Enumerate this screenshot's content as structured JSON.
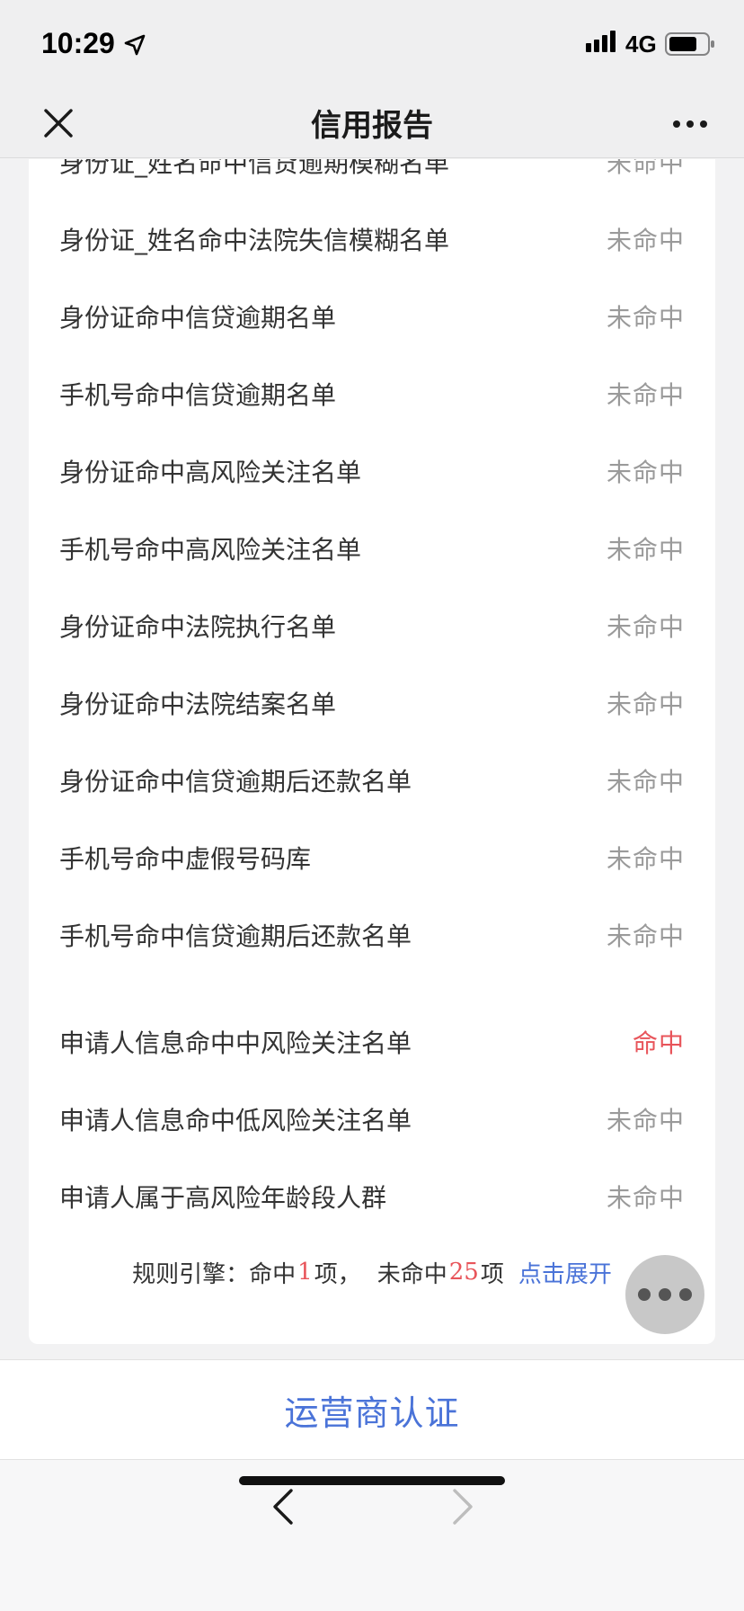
{
  "status_bar": {
    "time": "10:29",
    "network": "4G",
    "icons": [
      "location-arrow-icon",
      "signal-bars-icon",
      "battery-icon"
    ]
  },
  "nav": {
    "title": "信用报告",
    "close_icon": "close-icon",
    "more_icon": "more-dots-icon"
  },
  "rules": [
    {
      "label": "身份证_姓名命中信贷逾期模糊名单",
      "status": "未命中",
      "hit": false
    },
    {
      "label": "身份证_姓名命中法院失信模糊名单",
      "status": "未命中",
      "hit": false
    },
    {
      "label": "身份证命中信贷逾期名单",
      "status": "未命中",
      "hit": false
    },
    {
      "label": "手机号命中信贷逾期名单",
      "status": "未命中",
      "hit": false
    },
    {
      "label": "身份证命中高风险关注名单",
      "status": "未命中",
      "hit": false
    },
    {
      "label": "手机号命中高风险关注名单",
      "status": "未命中",
      "hit": false
    },
    {
      "label": "身份证命中法院执行名单",
      "status": "未命中",
      "hit": false
    },
    {
      "label": "身份证命中法院结案名单",
      "status": "未命中",
      "hit": false
    },
    {
      "label": "身份证命中信贷逾期后还款名单",
      "status": "未命中",
      "hit": false
    },
    {
      "label": "手机号命中虚假号码库",
      "status": "未命中",
      "hit": false
    },
    {
      "label": "手机号命中信贷逾期后还款名单",
      "status": "未命中",
      "hit": false
    },
    {
      "label": "申请人信息命中中风险关注名单",
      "status": "命中",
      "hit": true
    },
    {
      "label": "申请人信息命中低风险关注名单",
      "status": "未命中",
      "hit": false
    },
    {
      "label": "申请人属于高风险年龄段人群",
      "status": "未命中",
      "hit": false
    }
  ],
  "summary": {
    "prefix": "规则引擎：命中",
    "hit_count": "1",
    "hit_unit": "项，",
    "miss_prefix": "未命中",
    "miss_count": "25",
    "miss_unit": "项",
    "expand_label": "点击展开"
  },
  "auth": {
    "label": "运营商认证"
  },
  "toolbar": {
    "back_icon": "chevron-left-icon",
    "forward_icon": "chevron-right-icon"
  },
  "colors": {
    "hit": "#e8545a",
    "miss": "#9a9a9a",
    "link": "#4a73d8"
  }
}
